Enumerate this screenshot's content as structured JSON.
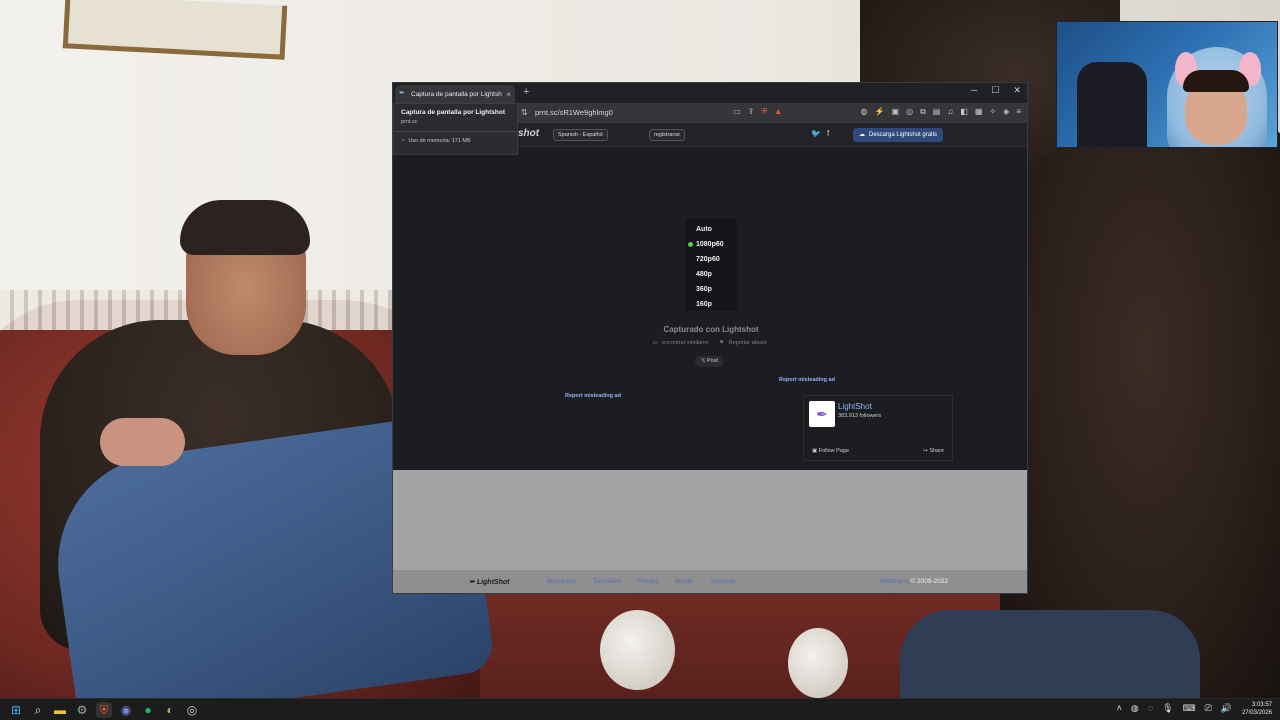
{
  "browser": {
    "tab_title": "Captura de pantalla por Lightshot",
    "new_tab": "+",
    "tab_close": "×",
    "url": "prnt.sc/sR1We9ghlmg0",
    "hovercard": {
      "title": "Captura de pantalla por Lightshot",
      "domain": "prnt.sc",
      "memory": "Uso de memoria: 171 MB"
    }
  },
  "page": {
    "header": {
      "logo_fragment": "shot",
      "language": "Spanish - Español",
      "register": "registrarse",
      "download": "Descarga Lightshot gratis"
    },
    "quality_menu": [
      "Auto",
      "1080p60",
      "720p60",
      "480p",
      "360p",
      "160p"
    ],
    "quality_selected": "1080p60",
    "captured": "Capturado con Lightshot",
    "similar": "encontrar similares",
    "report_abuse": "Reportar abuso",
    "post": "Post",
    "report_ad_1": "Report misleading ad",
    "report_ad_2": "Report misleading ad",
    "fb": {
      "name": "LightShot",
      "followers": "383,913 followers",
      "follow": "Follow Page",
      "share": "Share"
    },
    "footer": {
      "logo": "LightShot",
      "links": [
        "descargar",
        "Tutoriales",
        "Privacy",
        "ayuda",
        "anunciar"
      ],
      "company": "Skillbrains",
      "copyright": " © 2009-2022"
    }
  },
  "taskbar": {
    "time": "3:03:57",
    "date": "27/03/2026"
  }
}
